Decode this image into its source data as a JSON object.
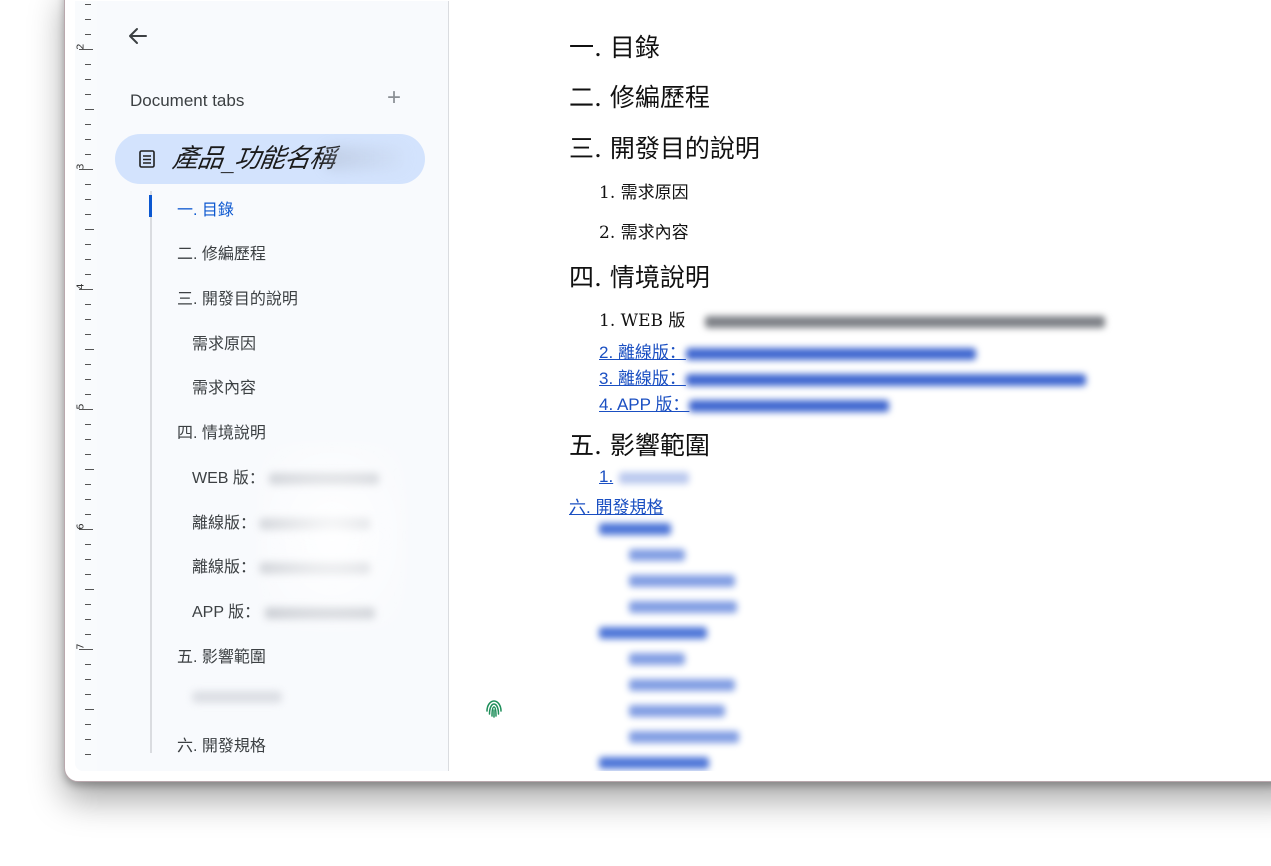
{
  "sidebar": {
    "title": "Document tabs",
    "add_label": "+",
    "active_tab": {
      "name": "產品_功能名稱",
      "icon": "document-icon"
    },
    "outline": [
      {
        "label": "一. 目錄",
        "active": true
      },
      {
        "label": "二. 修編歷程"
      },
      {
        "label": "三. 開發目的說明"
      },
      {
        "label": "需求原因"
      },
      {
        "label": "需求內容"
      },
      {
        "label": "四. 情境說明"
      },
      {
        "label": "WEB 版："
      },
      {
        "label": "離線版："
      },
      {
        "label": "離線版："
      },
      {
        "label": "APP 版："
      },
      {
        "label": "五. 影響範圍"
      },
      {
        "label": ""
      },
      {
        "label": "六. 開發規格"
      }
    ]
  },
  "document": {
    "headings": {
      "h1_1": "一. 目錄",
      "h1_2": "二. 修編歷程",
      "h1_3": "三. 開發目的說明",
      "h2_1": "1. 需求原因",
      "h2_2": "2. 需求內容",
      "h1_4": "四. 情境說明",
      "h2_3": "1. WEB 版",
      "link_1": "2. 離線版：",
      "link_2": "3. 離線版：",
      "link_3": "4. APP 版：",
      "h1_5": "五. 影響範圍",
      "link_4": "1.",
      "link_5": "六. 開發規格"
    }
  },
  "ruler": {
    "labels": [
      "2",
      "3",
      "4",
      "5",
      "6",
      "7"
    ]
  },
  "colors": {
    "accent": "#0b57d0",
    "active_tab_bg": "#d3e3fd",
    "link": "#1a4fc2"
  }
}
